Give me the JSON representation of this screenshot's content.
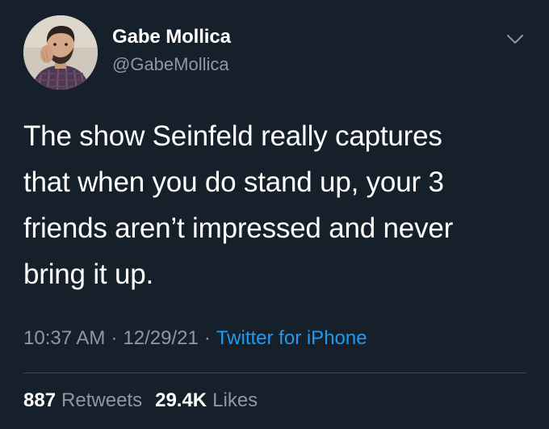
{
  "colors": {
    "background": "#15202b",
    "primary_text": "#ffffff",
    "secondary_text": "#8b98a5",
    "link": "#1d9bf0",
    "divider": "#38444d"
  },
  "author": {
    "display_name": "Gabe Mollica",
    "handle": "@GabeMollica",
    "avatar_icon": "profile-photo",
    "menu_icon": "chevron-down-icon"
  },
  "tweet": {
    "text": "The show Seinfeld really captures\nthat when you do stand up, your 3\nfriends aren’t impressed and never\nbring it up."
  },
  "meta": {
    "time": "10:37 AM",
    "separator": "·",
    "date": "12/29/21",
    "source": "Twitter for iPhone"
  },
  "stats": {
    "retweets_count": "887",
    "retweets_label": "Retweets",
    "likes_count": "29.4K",
    "likes_label": "Likes"
  }
}
